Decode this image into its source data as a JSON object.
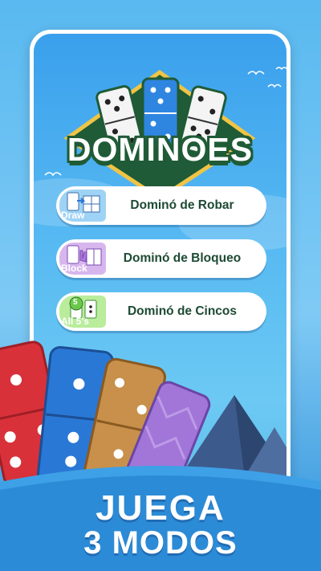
{
  "logo": {
    "title": "DOMINOES"
  },
  "modes": [
    {
      "label": "Dominó de Robar",
      "icon_tag": "Draw",
      "icon_color": "#9fd3f5",
      "accent": "#4a8ed6"
    },
    {
      "label": "Dominó de Bloqueo",
      "icon_tag": "Block",
      "icon_color": "#d7b6ee",
      "accent": "#8e55c9"
    },
    {
      "label": "Dominó de Cincos",
      "icon_tag": "All 5's",
      "icon_color": "#b9ec9b",
      "accent": "#46a53a"
    }
  ],
  "badge_number": "5",
  "banner": {
    "line1": "JUEGA",
    "line2": "3 MODOS"
  },
  "colors": {
    "logo_green": "#1f5b36",
    "tile_red": "#d8313a",
    "tile_blue": "#2a78d6",
    "tile_wood": "#c8904a",
    "tile_purple": "#a176d8"
  }
}
